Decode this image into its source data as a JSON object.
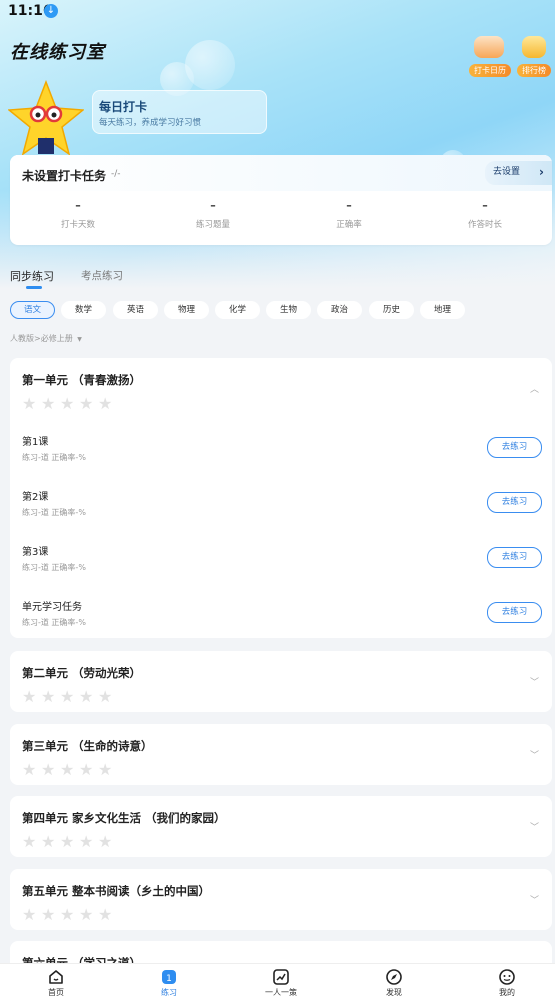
{
  "status": {
    "time": "11:16"
  },
  "header": {
    "app_title": "在线练习室",
    "checkin_calendar_label": "打卡日历",
    "leaderboard_label": "排行榜"
  },
  "daily": {
    "title": "每日打卡",
    "subtitle": "每天练习，养成学习好习惯"
  },
  "task": {
    "title": "未设置打卡任务",
    "fraction": "-/-",
    "set_button": "去设置",
    "stats": [
      {
        "value": "–",
        "label": "打卡天数"
      },
      {
        "value": "–",
        "label": "练习题量"
      },
      {
        "value": "–",
        "label": "正确率"
      },
      {
        "value": "–",
        "label": "作答时长"
      }
    ]
  },
  "tabs": [
    {
      "label": "同步练习",
      "active": true
    },
    {
      "label": "考点练习",
      "active": false
    }
  ],
  "subjects": [
    {
      "label": "语文",
      "active": true
    },
    {
      "label": "数学",
      "active": false
    },
    {
      "label": "英语",
      "active": false
    },
    {
      "label": "物理",
      "active": false
    },
    {
      "label": "化学",
      "active": false
    },
    {
      "label": "生物",
      "active": false
    },
    {
      "label": "政治",
      "active": false
    },
    {
      "label": "历史",
      "active": false
    },
    {
      "label": "地理",
      "active": false
    }
  ],
  "edition": "人教版>必修上册",
  "edition_arrow": "▼",
  "units": [
    {
      "title": "第一单元 （青春激扬）",
      "expanded": true,
      "lessons": [
        {
          "title": "第1课",
          "meta": "练习-道   正确率-%",
          "button": "去练习"
        },
        {
          "title": "第2课",
          "meta": "练习-道   正确率-%",
          "button": "去练习"
        },
        {
          "title": "第3课",
          "meta": "练习-道   正确率-%",
          "button": "去练习"
        },
        {
          "title": "单元学习任务",
          "meta": "练习-道   正确率-%",
          "button": "去练习"
        }
      ]
    },
    {
      "title": "第二单元 （劳动光荣）",
      "expanded": false
    },
    {
      "title": "第三单元 （生命的诗意）",
      "expanded": false
    },
    {
      "title": "第四单元 家乡文化生活 （我们的家园）",
      "expanded": false
    },
    {
      "title": "第五单元 整本书阅读（乡土的中国）",
      "expanded": false
    },
    {
      "title": "第六单元 （学习之道）",
      "expanded": false
    }
  ],
  "star_glyph": "★",
  "chevron_up": "︿",
  "chevron_down": "﹀",
  "nav": [
    {
      "label": "首页",
      "icon": "home-icon",
      "active": false
    },
    {
      "label": "练习",
      "icon": "practice-icon",
      "active": true
    },
    {
      "label": "一人一策",
      "icon": "trend-icon",
      "active": false
    },
    {
      "label": "发现",
      "icon": "compass-icon",
      "active": false
    },
    {
      "label": "我的",
      "icon": "profile-icon",
      "active": false
    }
  ],
  "colors": {
    "accent": "#2e8df0",
    "hero_bg": "#8fd6f7",
    "badge_orange": "#f58b2a"
  }
}
